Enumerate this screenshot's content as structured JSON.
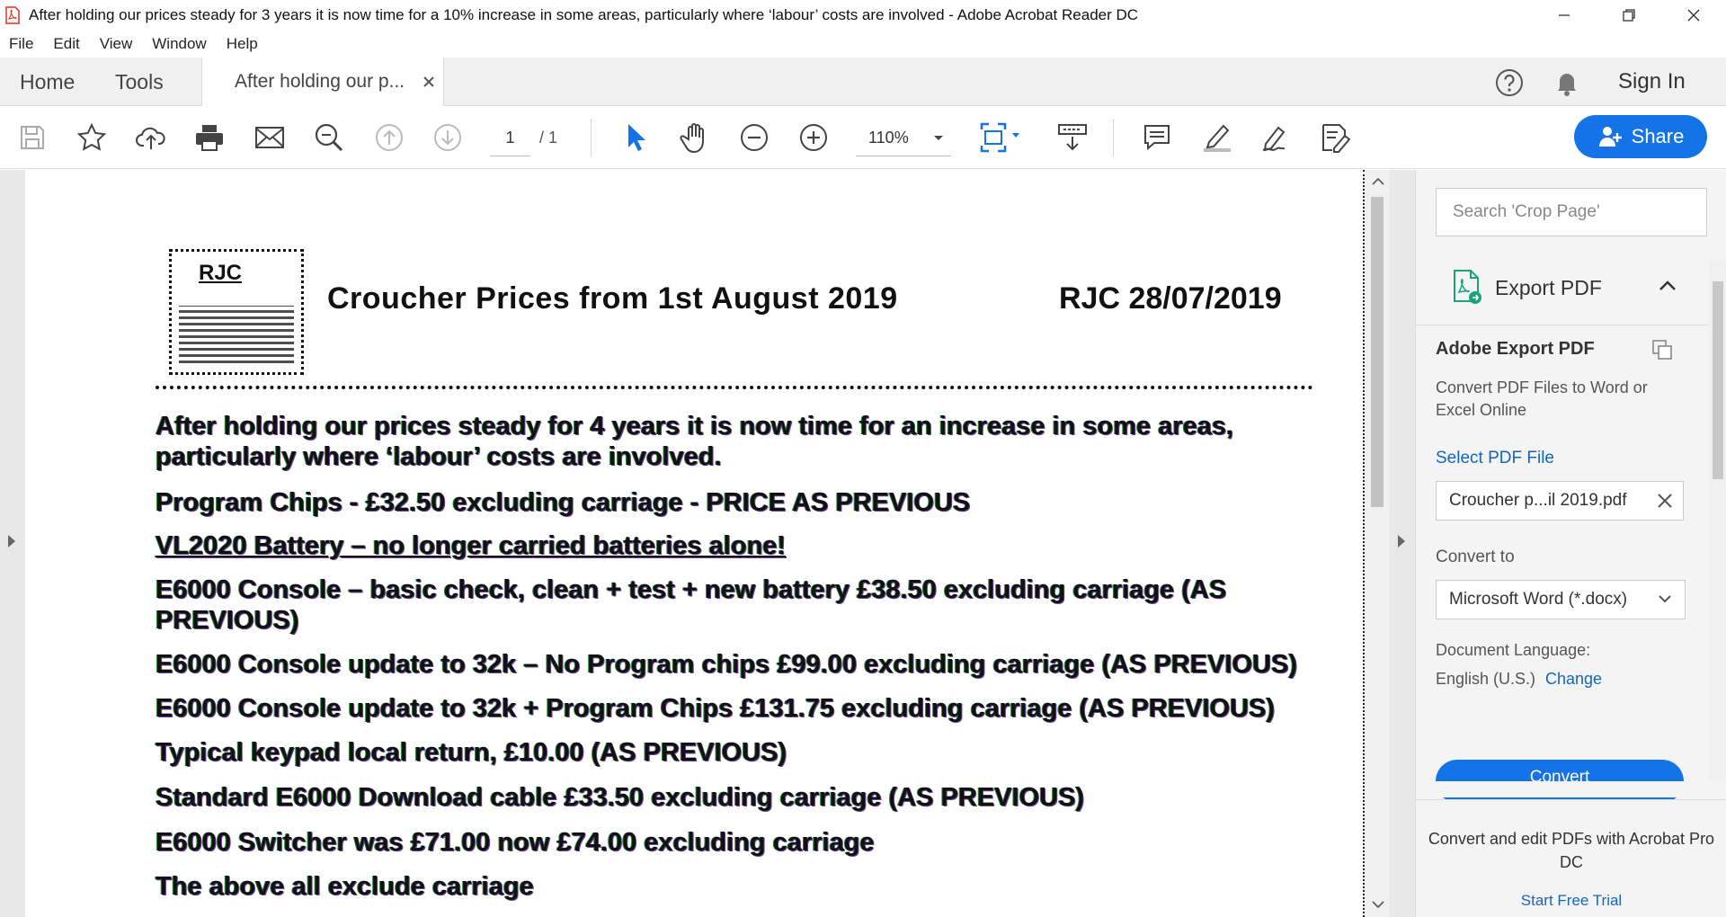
{
  "window": {
    "title": "After holding our prices steady for 3 years it is now time for a 10% increase in some areas, particularly where ‘labour’ costs are involved - Adobe Acrobat Reader DC"
  },
  "menu": [
    "File",
    "Edit",
    "View",
    "Window",
    "Help"
  ],
  "tabs": {
    "home": "Home",
    "tools": "Tools",
    "document": "After holding our p...",
    "signin": "Sign In"
  },
  "toolbar": {
    "page_current": "1",
    "page_total": "/ 1",
    "zoom": "110%",
    "share_label": "Share"
  },
  "document": {
    "heading": "Croucher Prices from 1st August 2019",
    "ref": "RJC 28/07/2019",
    "logo_text": "RJC",
    "paragraphs": [
      "After holding our prices steady for 4 years it is now time for an increase in some areas,",
      "particularly where ‘labour’ costs are involved.",
      "Program Chips - £32.50 excluding carriage - PRICE AS PREVIOUS",
      "VL2020 Battery – no longer carried batteries alone!",
      "E6000 Console – basic check, clean + test + new battery £38.50 excluding carriage (AS",
      "PREVIOUS)",
      "E6000 Console update to 32k – No Program chips £99.00 excluding carriage (AS PREVIOUS)",
      "E6000 Console update to 32k + Program Chips £131.75 excluding carriage (AS PREVIOUS)",
      "Typical keypad local return, £10.00 (AS PREVIOUS)",
      "Standard E6000 Download cable £33.50 excluding carriage (AS PREVIOUS)",
      "E6000 Switcher was £71.00 now £74.00 excluding carriage",
      "The above all exclude carriage"
    ]
  },
  "panel": {
    "search_placeholder": "Search 'Crop Page'",
    "export_label": "Export PDF",
    "adobe_export_title": "Adobe Export PDF",
    "adobe_export_desc": "Convert PDF Files to Word or Excel Online",
    "select_file_label": "Select PDF File",
    "file_name": "Croucher p...il 2019.pdf",
    "convert_to_label": "Convert to",
    "convert_to_value": "Microsoft Word (*.docx)",
    "doc_language_label": "Document Language:",
    "doc_language_value": "English (U.S.)",
    "change_label": "Change",
    "convert_button": "Convert",
    "promo_text": "Convert and edit PDFs with Acrobat Pro DC",
    "trial_link": "Start Free Trial"
  },
  "colors": {
    "accent": "#1473e6",
    "link": "#1565c0",
    "pdf_red": "#e0301e"
  },
  "icons": [
    "pdf-app-icon",
    "minimize-icon",
    "restore-icon",
    "close-icon",
    "help-icon",
    "bell-icon",
    "save-icon",
    "star-icon",
    "upload-icon",
    "print-icon",
    "email-icon",
    "search-icon",
    "page-up-icon",
    "page-down-icon",
    "select-arrow-icon",
    "hand-icon",
    "zoom-out-icon",
    "zoom-in-icon",
    "fit-page-icon",
    "read-mode-icon",
    "comment-icon",
    "highlight-icon",
    "sign-icon",
    "edit-icon",
    "add-user-icon"
  ]
}
